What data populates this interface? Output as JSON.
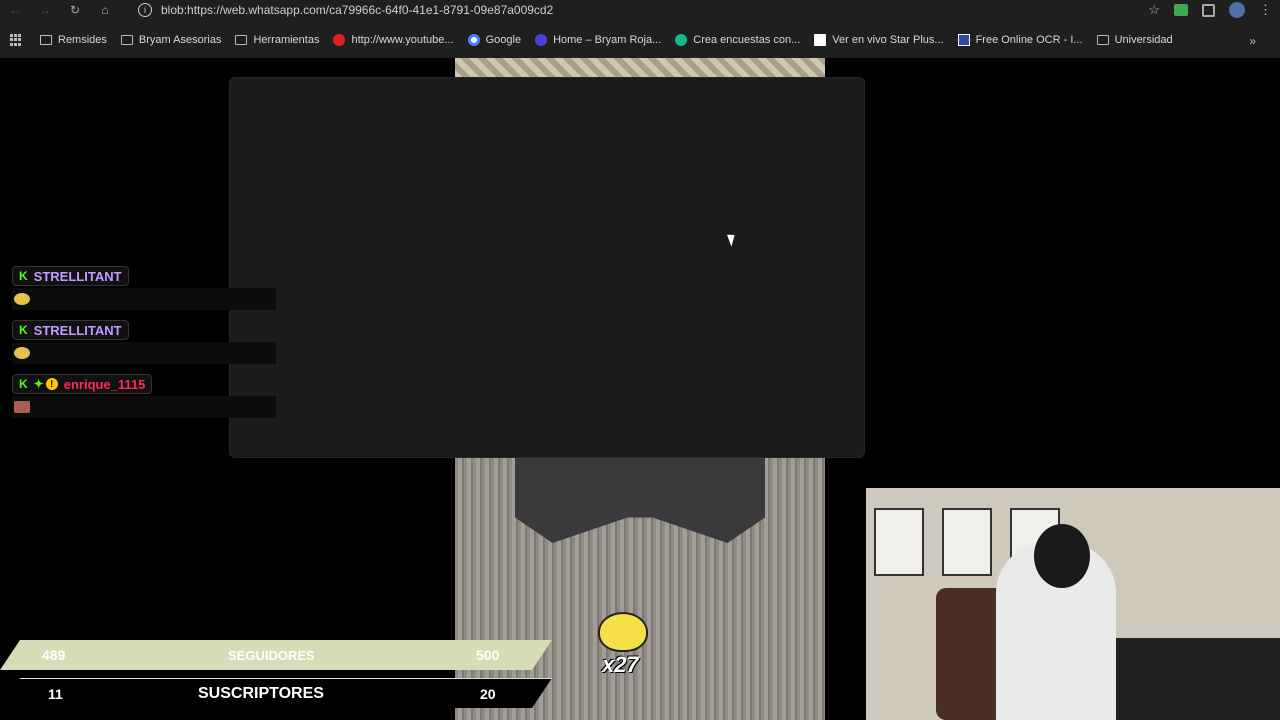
{
  "browser": {
    "url": "blob:https://web.whatsapp.com/ca79966c-64f0-41e1-8791-09e87a009cd2",
    "bookmarks": [
      {
        "label": "Remsides",
        "icon": "folder-icon"
      },
      {
        "label": "Bryam Asesorias",
        "icon": "folder-icon"
      },
      {
        "label": "Herramientas",
        "icon": "folder-icon"
      },
      {
        "label": "http://www.youtube...",
        "icon": "youtube-icon"
      },
      {
        "label": "Google",
        "icon": "google-icon"
      },
      {
        "label": "Home – Bryam Roja...",
        "icon": "site-icon"
      },
      {
        "label": "Crea encuestas con...",
        "icon": "survey-icon"
      },
      {
        "label": "Ver en vivo Star Plus...",
        "icon": "page-icon"
      },
      {
        "label": "Free Online OCR - I...",
        "icon": "ocr-icon"
      },
      {
        "label": "Universidad",
        "icon": "folder-icon"
      }
    ]
  },
  "chat": {
    "messages": [
      {
        "user": "STRELLITANT",
        "color": "#c49bff"
      },
      {
        "user": "STRELLITANT",
        "color": "#c49bff"
      },
      {
        "user": "enrique_1115",
        "color": "#ff2b55"
      }
    ]
  },
  "goals": {
    "followers": {
      "current": "489",
      "label": "SEGUIDORES",
      "target": "500"
    },
    "subs": {
      "current": "11",
      "label": "SUSCRIPTORES",
      "target": "20"
    }
  },
  "emote_combo": {
    "text": "x27"
  }
}
